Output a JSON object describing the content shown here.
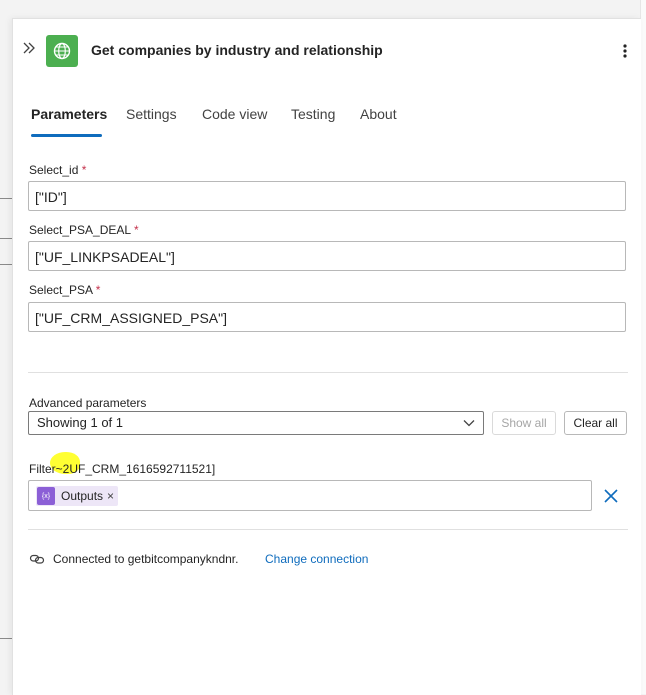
{
  "header": {
    "title": "Get companies by industry and relationship",
    "collapse_icon": "double-chevron-right-icon",
    "app_icon": "globe-icon",
    "app_icon_color": "#4caf50",
    "more_icon": "more-vertical-icon"
  },
  "tabs": [
    {
      "label": "Parameters",
      "active": true
    },
    {
      "label": "Settings",
      "active": false
    },
    {
      "label": "Code view",
      "active": false
    },
    {
      "label": "Testing",
      "active": false
    },
    {
      "label": "About",
      "active": false
    }
  ],
  "fields": [
    {
      "label": "Select_id",
      "required_mark": "*",
      "value": "[\"ID\"]"
    },
    {
      "label": "Select_PSA_DEAL",
      "required_mark": "*",
      "value": "[\"UF_LINKPSADEAL\"]"
    },
    {
      "label": "Select_PSA",
      "required_mark": "*",
      "value": "[\"UF_CRM_ASSIGNED_PSA\"]"
    }
  ],
  "advanced": {
    "label": "Advanced parameters",
    "selected": "Showing 1 of 1",
    "show_all_label": "Show all",
    "clear_all_label": "Clear all"
  },
  "filter": {
    "label": "Filter~2UF_CRM_1616592711521]",
    "token_label": "Outputs",
    "token_remove": "×",
    "token_icon_text": "{x}",
    "token_icon": "expression-icon",
    "remove_icon": "close-icon"
  },
  "connection": {
    "text": "Connected to getbitcompanykndnr.",
    "link": "Change connection",
    "icon": "link-icon"
  },
  "colors": {
    "accent": "#0f6cbd",
    "required": "#c4314b",
    "highlight": "#ffff33",
    "token_bg": "#ede6f7",
    "token_icon": "#8b5fd6"
  }
}
